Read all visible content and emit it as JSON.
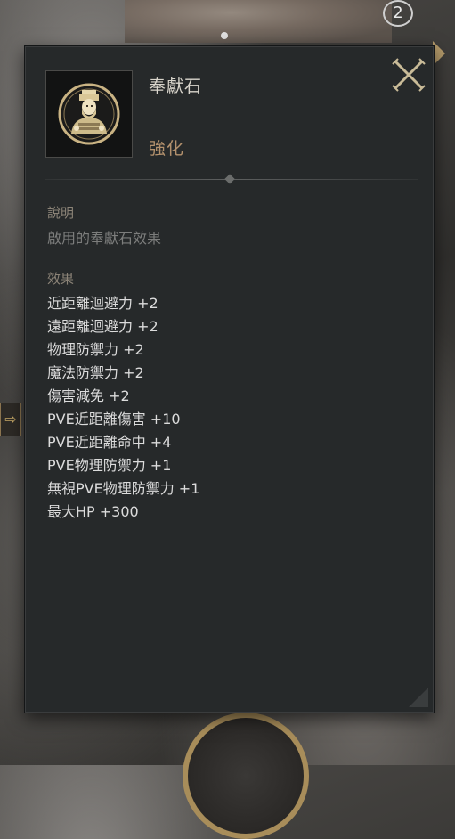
{
  "background": {
    "counter": "2"
  },
  "tooltip": {
    "item_name": "奉獻石",
    "item_category": "強化",
    "icon": "priest-figure-icon",
    "close_icon": "close-icon",
    "description": {
      "heading": "說明",
      "text": "啟用的奉獻石效果"
    },
    "effects": {
      "heading": "效果",
      "items": [
        "近距離迴避力 +2",
        "遠距離迴避力 +2",
        "物理防禦力 +2",
        "魔法防禦力 +2",
        "傷害減免 +2",
        "PVE近距離傷害 +10",
        "PVE近距離命中 +4",
        "PVE物理防禦力 +1",
        "無視PVE物理防禦力 +1",
        "最大HP +300"
      ]
    }
  },
  "colors": {
    "panel_bg": "#26292a",
    "accent_gold": "#b3916d",
    "effect_text": "#dcdcdc",
    "heading_text": "#8b8377"
  }
}
